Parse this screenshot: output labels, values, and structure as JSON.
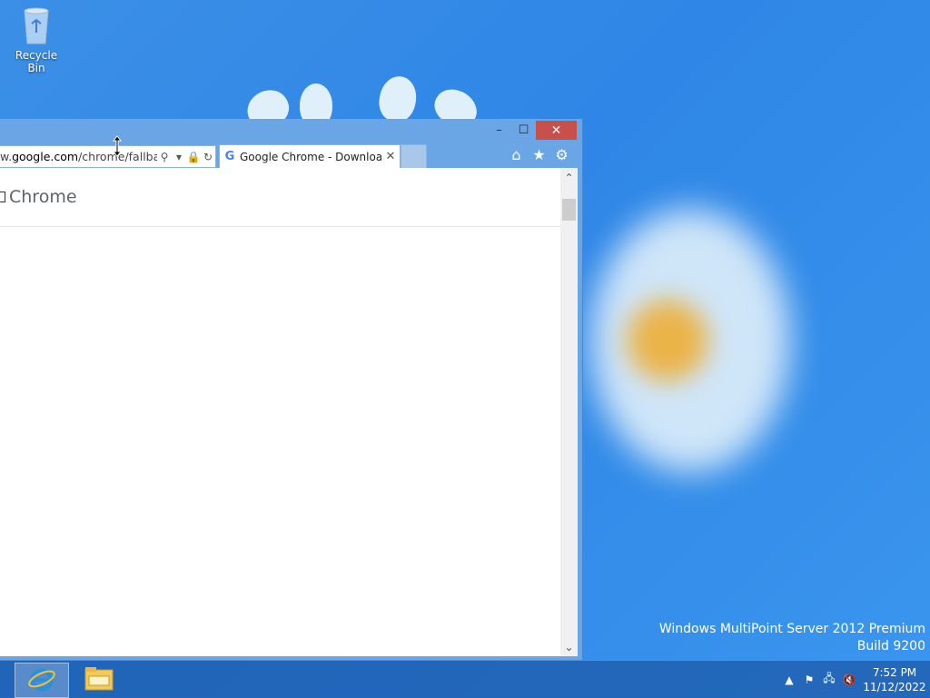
{
  "desktop": {
    "recycle_bin_label": "Recycle Bin",
    "watermark_line1": "Windows MultiPoint Server 2012 Premium",
    "watermark_line2": "Build 9200"
  },
  "browser": {
    "address_prefix": "w.",
    "address_domain": "google.com",
    "address_path": "/chrome/fallbac",
    "tab_title": "Google Chrome - Downloa...",
    "tab_favicon": "G",
    "page_brand": "Chrome"
  },
  "taskbar": {
    "items": [
      "internet-explorer",
      "file-explorer"
    ],
    "clock_time": "7:52 PM",
    "clock_date": "11/12/2022"
  }
}
